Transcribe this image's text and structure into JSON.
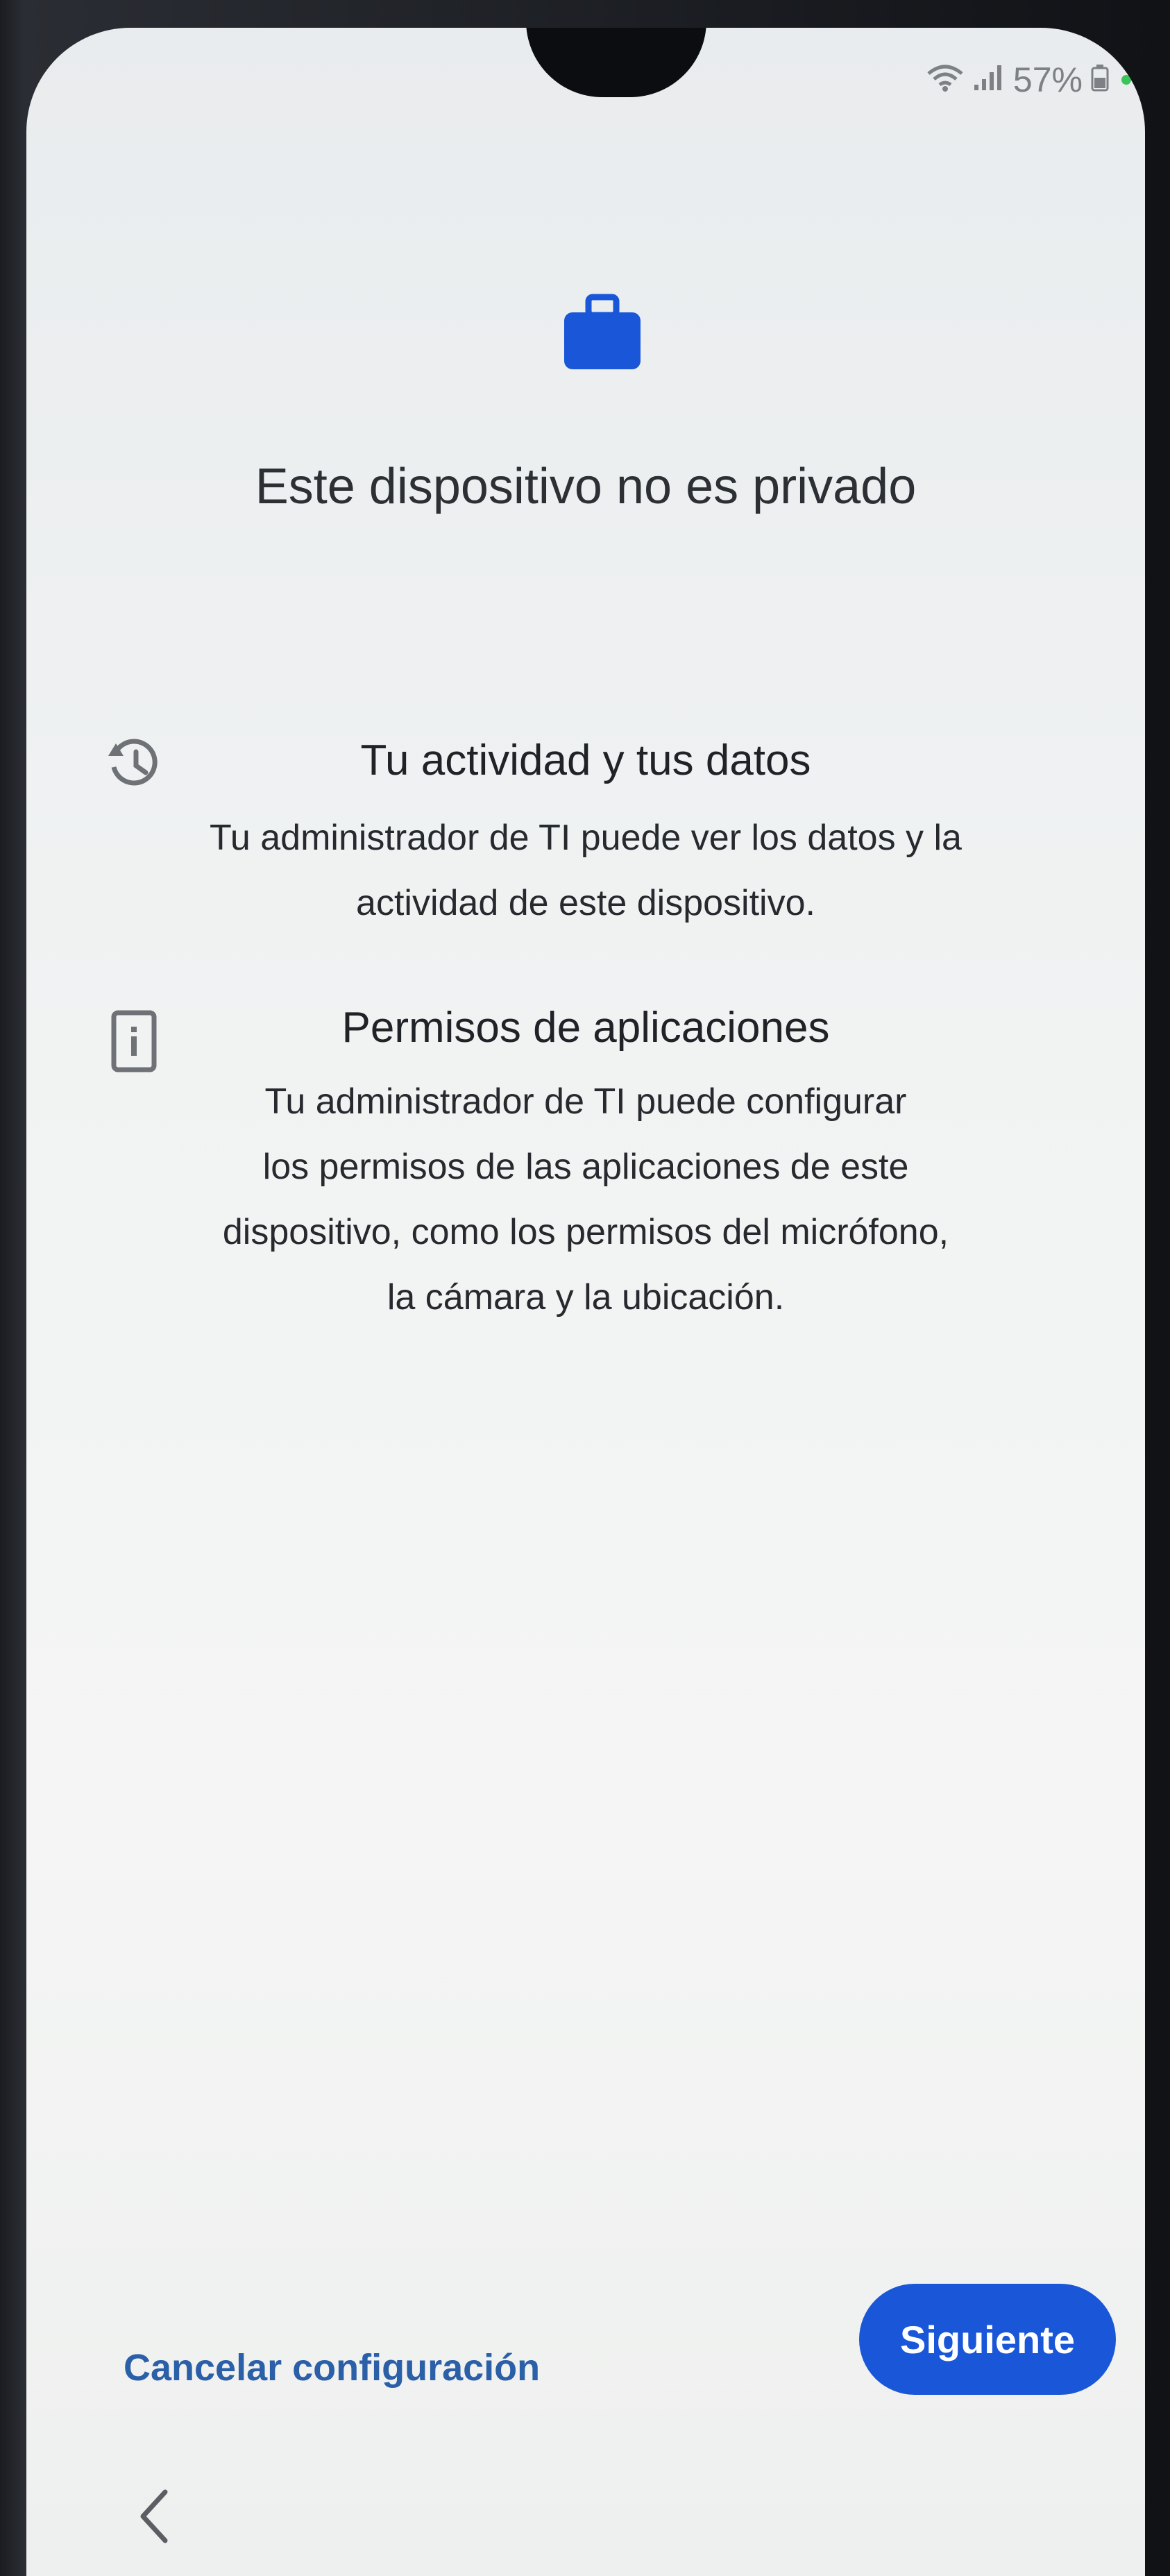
{
  "status_bar": {
    "battery_text": "57%",
    "icons": [
      "wifi-icon",
      "signal-icon",
      "battery-icon",
      "green-dot-indicator"
    ]
  },
  "header": {
    "icon": "briefcase-icon",
    "title": "Este dispositivo no es privado"
  },
  "sections": [
    {
      "icon": "history-icon",
      "heading": "Tu actividad y tus datos",
      "lines": [
        "Tu administrador de TI puede ver los datos y la",
        "actividad de este dispositivo."
      ]
    },
    {
      "icon": "device-info-icon",
      "heading": "Permisos de aplicaciones",
      "lines": [
        "Tu administrador de TI puede configurar",
        "los permisos de las aplicaciones de este",
        "dispositivo, como los permisos del micrófono,",
        "la cámara y la ubicación."
      ]
    }
  ],
  "footer": {
    "cancel_label": "Cancelar configuración",
    "next_label": "Siguiente"
  },
  "navigation": {
    "back_icon": "back-chevron-icon"
  },
  "colors": {
    "accent": "#1957d8",
    "link": "#2b5fa8",
    "text": "#26292d"
  }
}
